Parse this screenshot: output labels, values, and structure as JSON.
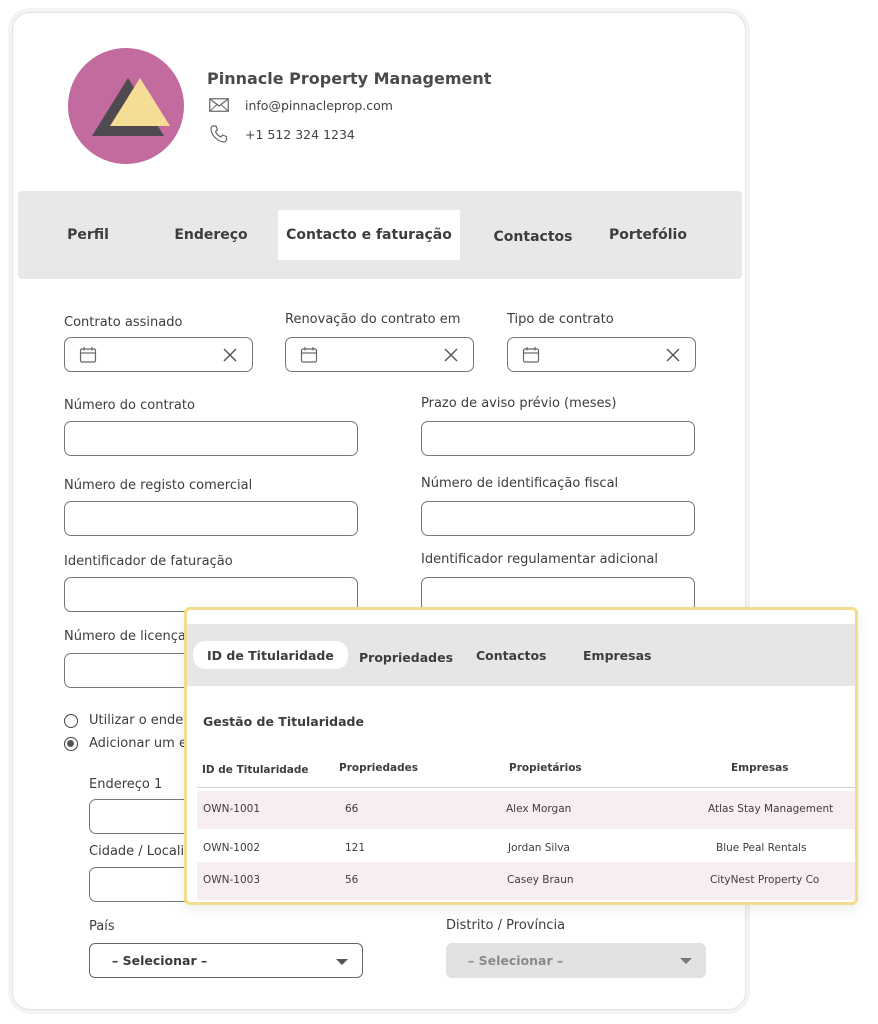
{
  "company": {
    "name": "Pinnacle Property Management",
    "email": "info@pinnacleprop.com",
    "phone": "+1 512 324 1234",
    "icons": {
      "email": "envelope-icon",
      "phone": "phone-icon"
    },
    "avatar_colors": {
      "background": "#c36a9f",
      "triangle_dark": "#4f4a50",
      "triangle_light": "#f6dd95"
    }
  },
  "tabs": [
    {
      "label": "Perfil",
      "active": false
    },
    {
      "label": "Endereço",
      "active": false
    },
    {
      "label": "Contacto e faturação",
      "active": true
    },
    {
      "label": "Contactos",
      "active": false
    },
    {
      "label": "Portefólio",
      "active": false
    }
  ],
  "form": {
    "contract_signed": {
      "label": "Contrato assinado",
      "value": ""
    },
    "contract_renewal": {
      "label": "Renovação do contrato em",
      "value": ""
    },
    "contract_type": {
      "label": "Tipo de contrato",
      "value": ""
    },
    "contract_number": {
      "label": "Número do contrato",
      "value": ""
    },
    "notice_period": {
      "label": "Prazo de aviso prévio (meses)",
      "value": ""
    },
    "commercial_registry": {
      "label": "Número de registo comercial",
      "value": ""
    },
    "tax_id": {
      "label": "Número de identificação fiscal",
      "value": ""
    },
    "billing_id": {
      "label": "Identificador de faturação",
      "value": ""
    },
    "additional_regulatory_id": {
      "label": "Identificador regulamentar adicional",
      "value": ""
    },
    "license_number": {
      "label": "Número de licença ",
      "value": ""
    },
    "address_options": [
      {
        "label": "Utilizar o endere",
        "checked": false
      },
      {
        "label": "Adicionar um en",
        "checked": true
      }
    ],
    "address1": {
      "label": "Endereço 1",
      "value": ""
    },
    "city": {
      "label": "Cidade / Locali",
      "value": ""
    },
    "country": {
      "label": "País",
      "selected": "– Selecionar –"
    },
    "district": {
      "label": "Distrito / Província",
      "selected": "– Selecionar –"
    }
  },
  "overlay": {
    "tabs": [
      {
        "label": "ID de Titularidade",
        "active": true
      },
      {
        "label": "Propriedades",
        "active": false
      },
      {
        "label": "Contactos",
        "active": false
      },
      {
        "label": "Empresas",
        "active": false
      }
    ],
    "title": "Gestão de Titularidade",
    "columns": [
      "ID de Titularidade",
      "Propriedades",
      "Propietários",
      "Empresas"
    ],
    "rows": [
      {
        "id": "OWN-1001",
        "properties": "66",
        "owner": "Alex Morgan",
        "company": "Atlas Stay Management"
      },
      {
        "id": "OWN-1002",
        "properties": "121",
        "owner": "Jordan Silva",
        "company": "Blue Peal Rentals"
      },
      {
        "id": "OWN-1003",
        "properties": "56",
        "owner": "Casey Braun",
        "company": "CityNest Property Co"
      }
    ],
    "colors": {
      "border": "#f5dc8a",
      "row_shade": "#f8eef1"
    }
  }
}
